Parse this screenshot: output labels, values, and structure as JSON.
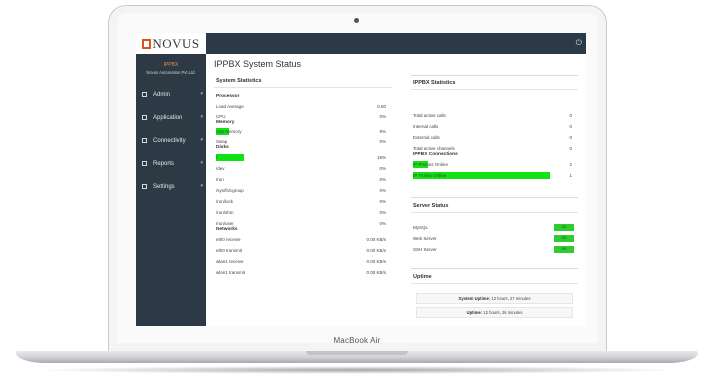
{
  "device": {
    "model_label": "MacBook Air"
  },
  "app": {
    "logo_text": "NOVUS",
    "product": "IPPBX",
    "organization": "Novus Automation Pvt.Ltd.",
    "page_title": "IPPBX System Status"
  },
  "sidebar": {
    "items": [
      {
        "label": "Admin"
      },
      {
        "label": "Application"
      },
      {
        "label": "Connectivity"
      },
      {
        "label": "Reports"
      },
      {
        "label": "Settings"
      }
    ]
  },
  "system_statistics": {
    "title": "System Statistics",
    "processor": {
      "title": "Processor",
      "rows": [
        {
          "label": "Load Average",
          "value": "0.60"
        },
        {
          "label": "CPU",
          "value": "0%"
        }
      ]
    },
    "memory": {
      "title": "Memory",
      "rows": [
        {
          "label": "App Memory",
          "value": "9%",
          "percent": 9
        },
        {
          "label": "Swap",
          "value": "0%",
          "percent": 0
        }
      ]
    },
    "disks": {
      "title": "Disks",
      "rows": [
        {
          "label": "/",
          "value": "19%",
          "percent": 19
        },
        {
          "label": "/dev",
          "value": "0%",
          "percent": 0
        },
        {
          "label": "/run",
          "value": "0%",
          "percent": 0
        },
        {
          "label": "/sys/fs/cgroup",
          "value": "0%",
          "percent": 0
        },
        {
          "label": "/run/lock",
          "value": "0%",
          "percent": 0
        },
        {
          "label": "/run/shm",
          "value": "0%",
          "percent": 0
        },
        {
          "label": "/run/user",
          "value": "0%",
          "percent": 0
        }
      ]
    },
    "networks": {
      "title": "Networks",
      "rows": [
        {
          "label": "eth0 receive",
          "value": "0.00 KB/s"
        },
        {
          "label": "eth0 transmit",
          "value": "0.00 KB/s"
        },
        {
          "label": "wlan1 receive",
          "value": "0.00 KB/s"
        },
        {
          "label": "wlan1 transmit",
          "value": "0.00 KB/s"
        }
      ]
    }
  },
  "ippbx_statistics": {
    "title": "IPPBX Statistics",
    "rows": [
      {
        "label": "Total active calls",
        "value": "0"
      },
      {
        "label": "Internal calls",
        "value": "0"
      },
      {
        "label": "External calls",
        "value": "0"
      },
      {
        "label": "Total active channels",
        "value": "0"
      }
    ],
    "connections": {
      "title": "IPPBX Connections",
      "rows": [
        {
          "label": "IP Phones Online",
          "value": "2",
          "percent": 11
        },
        {
          "label": "IP Trunks Online",
          "value": "1",
          "percent": 100
        }
      ]
    }
  },
  "server_status": {
    "title": "Server Status",
    "rows": [
      {
        "label": "MySQL",
        "status": "OK"
      },
      {
        "label": "Web Server",
        "status": "OK"
      },
      {
        "label": "SSH Server",
        "status": "OK"
      }
    ]
  },
  "uptime": {
    "title": "Uptime",
    "system_label": "System Uptime:",
    "system_value": "12 hours, 27 minutes",
    "service_label": "Uptime:",
    "service_value": "12 hours, 26 minutes"
  },
  "colors": {
    "sidebar_bg": "#2d3a45",
    "accent_orange": "#f0883e",
    "logo_red": "#d9531e",
    "usage_green": "#11e211",
    "ok_green": "#2ecc2e"
  }
}
